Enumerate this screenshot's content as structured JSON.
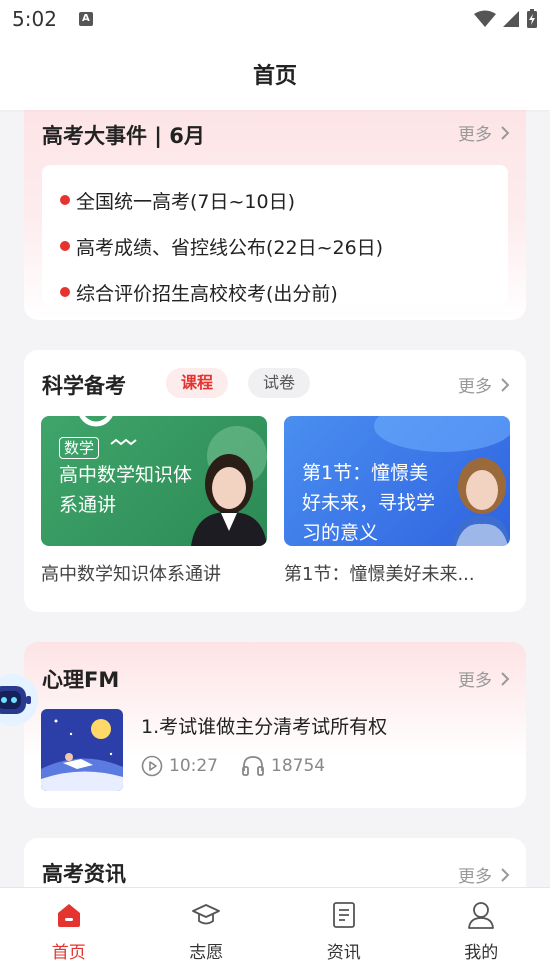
{
  "status_bar": {
    "time": "5:02"
  },
  "header": {
    "title": "首页"
  },
  "events": {
    "title": "高考大事件 | 6月",
    "more": "更多",
    "items": [
      "全国统一高考(7日~10日)",
      "高考成绩、省控线公布(22日~26日)",
      "综合评价招生高校校考(出分前)"
    ]
  },
  "prep": {
    "title": "科学备考",
    "tabs": [
      "课程",
      "试卷"
    ],
    "more": "更多",
    "courses": [
      {
        "badge": "数学",
        "thumb_text_line1": "高中数学知识体",
        "thumb_text_line2": "系通讲",
        "caption": "高中数学知识体系通讲"
      },
      {
        "thumb_text_line1": "第1节：憧憬美",
        "thumb_text_line2": "好未来，寻找学",
        "thumb_text_line3": "习的意义",
        "caption": "第1节：憧憬美好未来..."
      }
    ]
  },
  "fm": {
    "title": "心理FM",
    "more": "更多",
    "episode": {
      "title": "1.考试谁做主分清考试所有权",
      "duration": "10:27",
      "listens": "18754"
    }
  },
  "news": {
    "title": "高考资讯",
    "more": "更多"
  },
  "tabbar": {
    "items": [
      {
        "label": "首页",
        "icon": "home-icon",
        "active": true
      },
      {
        "label": "志愿",
        "icon": "graduation-cap-icon",
        "active": false
      },
      {
        "label": "资讯",
        "icon": "news-icon",
        "active": false
      },
      {
        "label": "我的",
        "icon": "user-icon",
        "active": false
      }
    ]
  },
  "colors": {
    "accent": "#e5342f",
    "background": "#f4f4f6"
  }
}
